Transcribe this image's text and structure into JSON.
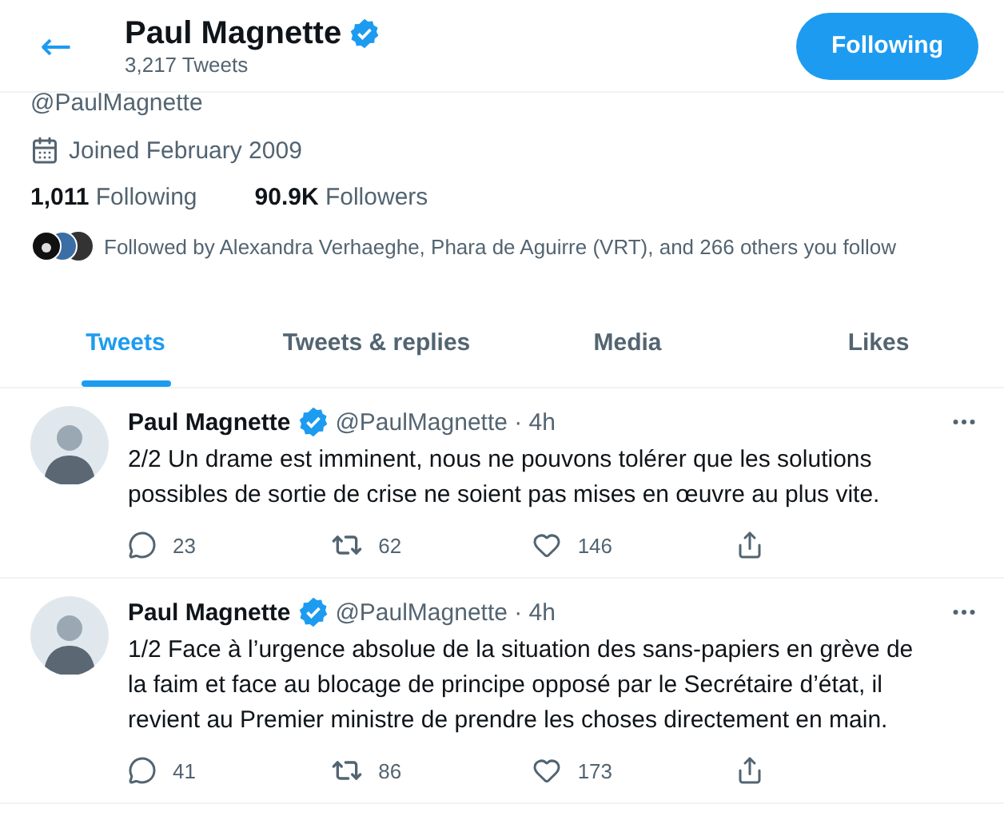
{
  "header": {
    "back": "←",
    "name": "Paul Magnette",
    "verified": true,
    "tweet_count": "3,217 Tweets",
    "follow_button": "Following"
  },
  "profile": {
    "handle": "@PaulMagnette",
    "joined": "Joined February 2009",
    "stats": [
      {
        "value": "1,011",
        "label": "Following"
      },
      {
        "value": "90.9K",
        "label": "Followers"
      }
    ],
    "followed_by": "Followed by Alexandra Verhaeghe, Phara de Aguirre (VRT), and 266 others you follow"
  },
  "tabs": [
    {
      "label": "Tweets",
      "selected": true
    },
    {
      "label": "Tweets & replies",
      "selected": false
    },
    {
      "label": "Media",
      "selected": false
    },
    {
      "label": "Likes",
      "selected": false
    }
  ],
  "tweets": [
    {
      "name": "Paul Magnette",
      "verified": true,
      "handle": "@PaulMagnette · 4h",
      "text": "2/2 Un drame est imminent, nous ne pouvons tolérer que les solutions possibles de sortie de crise ne soient pas mises en œuvre au plus vite.",
      "replies": "23",
      "retweets": "62",
      "likes": "146"
    },
    {
      "name": "Paul Magnette",
      "verified": true,
      "handle": "@PaulMagnette · 4h",
      "text": "1/2 Face à l’urgence absolue de la situation des sans-papiers en grève de la faim et face au blocage de principe opposé par le Secrétaire d’état, il revient au Premier ministre de prendre les choses directement en main.",
      "replies": "41",
      "retweets": "86",
      "likes": "173"
    }
  ]
}
